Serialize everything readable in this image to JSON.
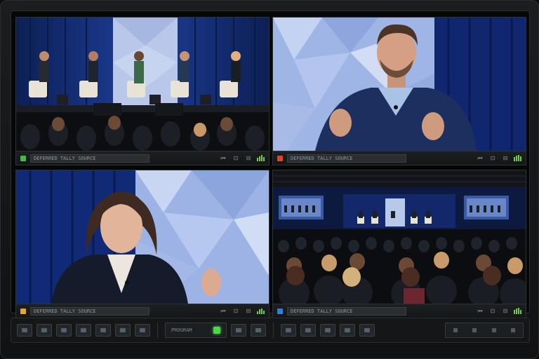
{
  "tiles": [
    {
      "id": "cam1",
      "tally_color": "#3fbf3f",
      "label": "DEFERRED TALLY SOURCE"
    },
    {
      "id": "cam2",
      "tally_color": "#e0442f",
      "label": "DEFERRED TALLY SOURCE"
    },
    {
      "id": "cam3",
      "tally_color": "#e5a626",
      "label": "DEFERRED TALLY SOURCE"
    },
    {
      "id": "cam4",
      "tally_color": "#2f7fe0",
      "label": "DEFERRED TALLY SOURCE"
    }
  ],
  "icons": {
    "prev": "⏮",
    "capture": "⊡",
    "menu": "⊟"
  },
  "control_strip": {
    "mode_text": "PROGRAM",
    "status_color": "#4fd64a"
  }
}
